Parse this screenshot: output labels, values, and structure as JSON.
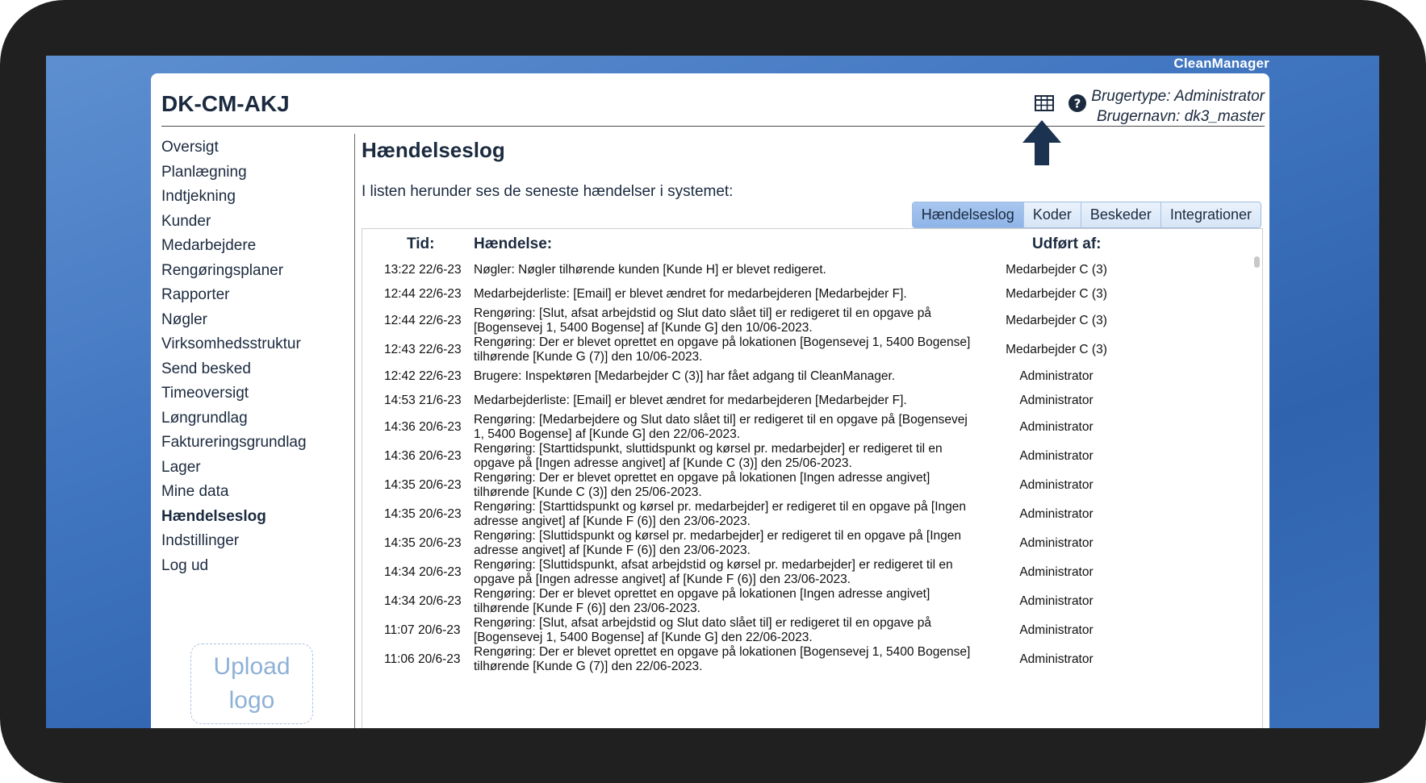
{
  "brand": "CleanManager",
  "company": "DK-CM-AKJ",
  "user": {
    "type": "Brugertype: Administrator",
    "name": "Brugernavn: dk3_master"
  },
  "icons": {
    "table": "table-grid-icon",
    "help": "help-circle-icon",
    "arrow": "arrow-up-icon"
  },
  "sidebar": {
    "items": [
      {
        "label": "Oversigt",
        "active": false
      },
      {
        "label": "Planlægning",
        "active": false
      },
      {
        "label": "Indtjekning",
        "active": false
      },
      {
        "label": "Kunder",
        "active": false
      },
      {
        "label": "Medarbejdere",
        "active": false
      },
      {
        "label": "Rengøringsplaner",
        "active": false
      },
      {
        "label": "Rapporter",
        "active": false
      },
      {
        "label": "Nøgler",
        "active": false
      },
      {
        "label": "Virksomhedsstruktur",
        "active": false
      },
      {
        "label": "Send besked",
        "active": false
      },
      {
        "label": "Timeoversigt",
        "active": false
      },
      {
        "label": "Løngrundlag",
        "active": false
      },
      {
        "label": "Faktureringsgrundlag",
        "active": false
      },
      {
        "label": "Lager",
        "active": false
      },
      {
        "label": "Mine data",
        "active": false
      },
      {
        "label": "Hændelseslog",
        "active": true
      },
      {
        "label": "Indstillinger",
        "active": false
      },
      {
        "label": "Log ud",
        "active": false
      }
    ],
    "upload_logo_line1": "Upload",
    "upload_logo_line2": "logo"
  },
  "main": {
    "title": "Hændelseslog",
    "intro": "I listen herunder ses de seneste hændelser i systemet:",
    "tabs": [
      {
        "label": "Hændelseslog",
        "active": true
      },
      {
        "label": "Koder",
        "active": false
      },
      {
        "label": "Beskeder",
        "active": false
      },
      {
        "label": "Integrationer",
        "active": false
      }
    ],
    "columns": {
      "time": "Tid:",
      "event": "Hændelse:",
      "by": "Udført af:"
    },
    "rows": [
      {
        "time": "13:22 22/6-23",
        "event": "Nøgler: Nøgler tilhørende kunden [Kunde H] er blevet redigeret.",
        "by": "Medarbejder C (3)",
        "lines": 1
      },
      {
        "time": "12:44 22/6-23",
        "event": "Medarbejderliste: [Email] er blevet ændret for medarbejderen [Medarbejder F].",
        "by": "Medarbejder C (3)",
        "lines": 1
      },
      {
        "time": "12:44 22/6-23",
        "event": "Rengøring: [Slut, afsat arbejdstid og Slut dato slået til] er redigeret til en opgave på [Bogensevej 1, 5400 Bogense] af [Kunde G] den 10/06-2023.",
        "by": "Medarbejder C (3)",
        "lines": 2
      },
      {
        "time": "12:43 22/6-23",
        "event": "Rengøring: Der er blevet oprettet en opgave på lokationen [Bogensevej 1, 5400 Bogense] tilhørende [Kunde G (7)] den 10/06-2023.",
        "by": "Medarbejder C (3)",
        "lines": 2
      },
      {
        "time": "12:42 22/6-23",
        "event": "Brugere: Inspektøren [Medarbejder C (3)] har fået adgang til CleanManager.",
        "by": "Administrator",
        "lines": 1
      },
      {
        "time": "14:53 21/6-23",
        "event": "Medarbejderliste: [Email] er blevet ændret for medarbejderen [Medarbejder F].",
        "by": "Administrator",
        "lines": 1
      },
      {
        "time": "14:36 20/6-23",
        "event": "Rengøring: [Medarbejdere og Slut dato slået til] er redigeret til en opgave på [Bogensevej 1, 5400 Bogense] af [Kunde G] den 22/06-2023.",
        "by": "Administrator",
        "lines": 2
      },
      {
        "time": "14:36 20/6-23",
        "event": "Rengøring: [Starttidspunkt, sluttidspunkt og kørsel pr. medarbejder] er redigeret til en opgave på [Ingen adresse angivet] af [Kunde C (3)] den 25/06-2023.",
        "by": "Administrator",
        "lines": 2
      },
      {
        "time": "14:35 20/6-23",
        "event": "Rengøring: Der er blevet oprettet en opgave på lokationen [Ingen adresse angivet] tilhørende [Kunde C (3)] den 25/06-2023.",
        "by": "Administrator",
        "lines": 2
      },
      {
        "time": "14:35 20/6-23",
        "event": "Rengøring: [Starttidspunkt og kørsel pr. medarbejder] er redigeret til en opgave på [Ingen adresse angivet] af [Kunde F (6)] den 23/06-2023.",
        "by": "Administrator",
        "lines": 2
      },
      {
        "time": "14:35 20/6-23",
        "event": "Rengøring: [Sluttidspunkt og kørsel pr. medarbejder] er redigeret til en opgave på [Ingen adresse angivet] af [Kunde F (6)] den 23/06-2023.",
        "by": "Administrator",
        "lines": 2
      },
      {
        "time": "14:34 20/6-23",
        "event": "Rengøring: [Sluttidspunkt, afsat arbejdstid og kørsel pr. medarbejder] er redigeret til en opgave på [Ingen adresse angivet] af [Kunde F (6)] den 23/06-2023.",
        "by": "Administrator",
        "lines": 2
      },
      {
        "time": "14:34 20/6-23",
        "event": "Rengøring: Der er blevet oprettet en opgave på lokationen [Ingen adresse angivet] tilhørende [Kunde F (6)] den 23/06-2023.",
        "by": "Administrator",
        "lines": 2
      },
      {
        "time": "11:07 20/6-23",
        "event": "Rengøring: [Slut, afsat arbejdstid og Slut dato slået til] er redigeret til en opgave på [Bogensevej 1, 5400 Bogense] af [Kunde G] den 22/06-2023.",
        "by": "Administrator",
        "lines": 2
      },
      {
        "time": "11:06 20/6-23",
        "event": "Rengøring: Der er blevet oprettet en opgave på lokationen [Bogensevej 1, 5400 Bogense] tilhørende [Kunde G (7)] den 22/06-2023.",
        "by": "Administrator",
        "lines": 2
      }
    ]
  }
}
